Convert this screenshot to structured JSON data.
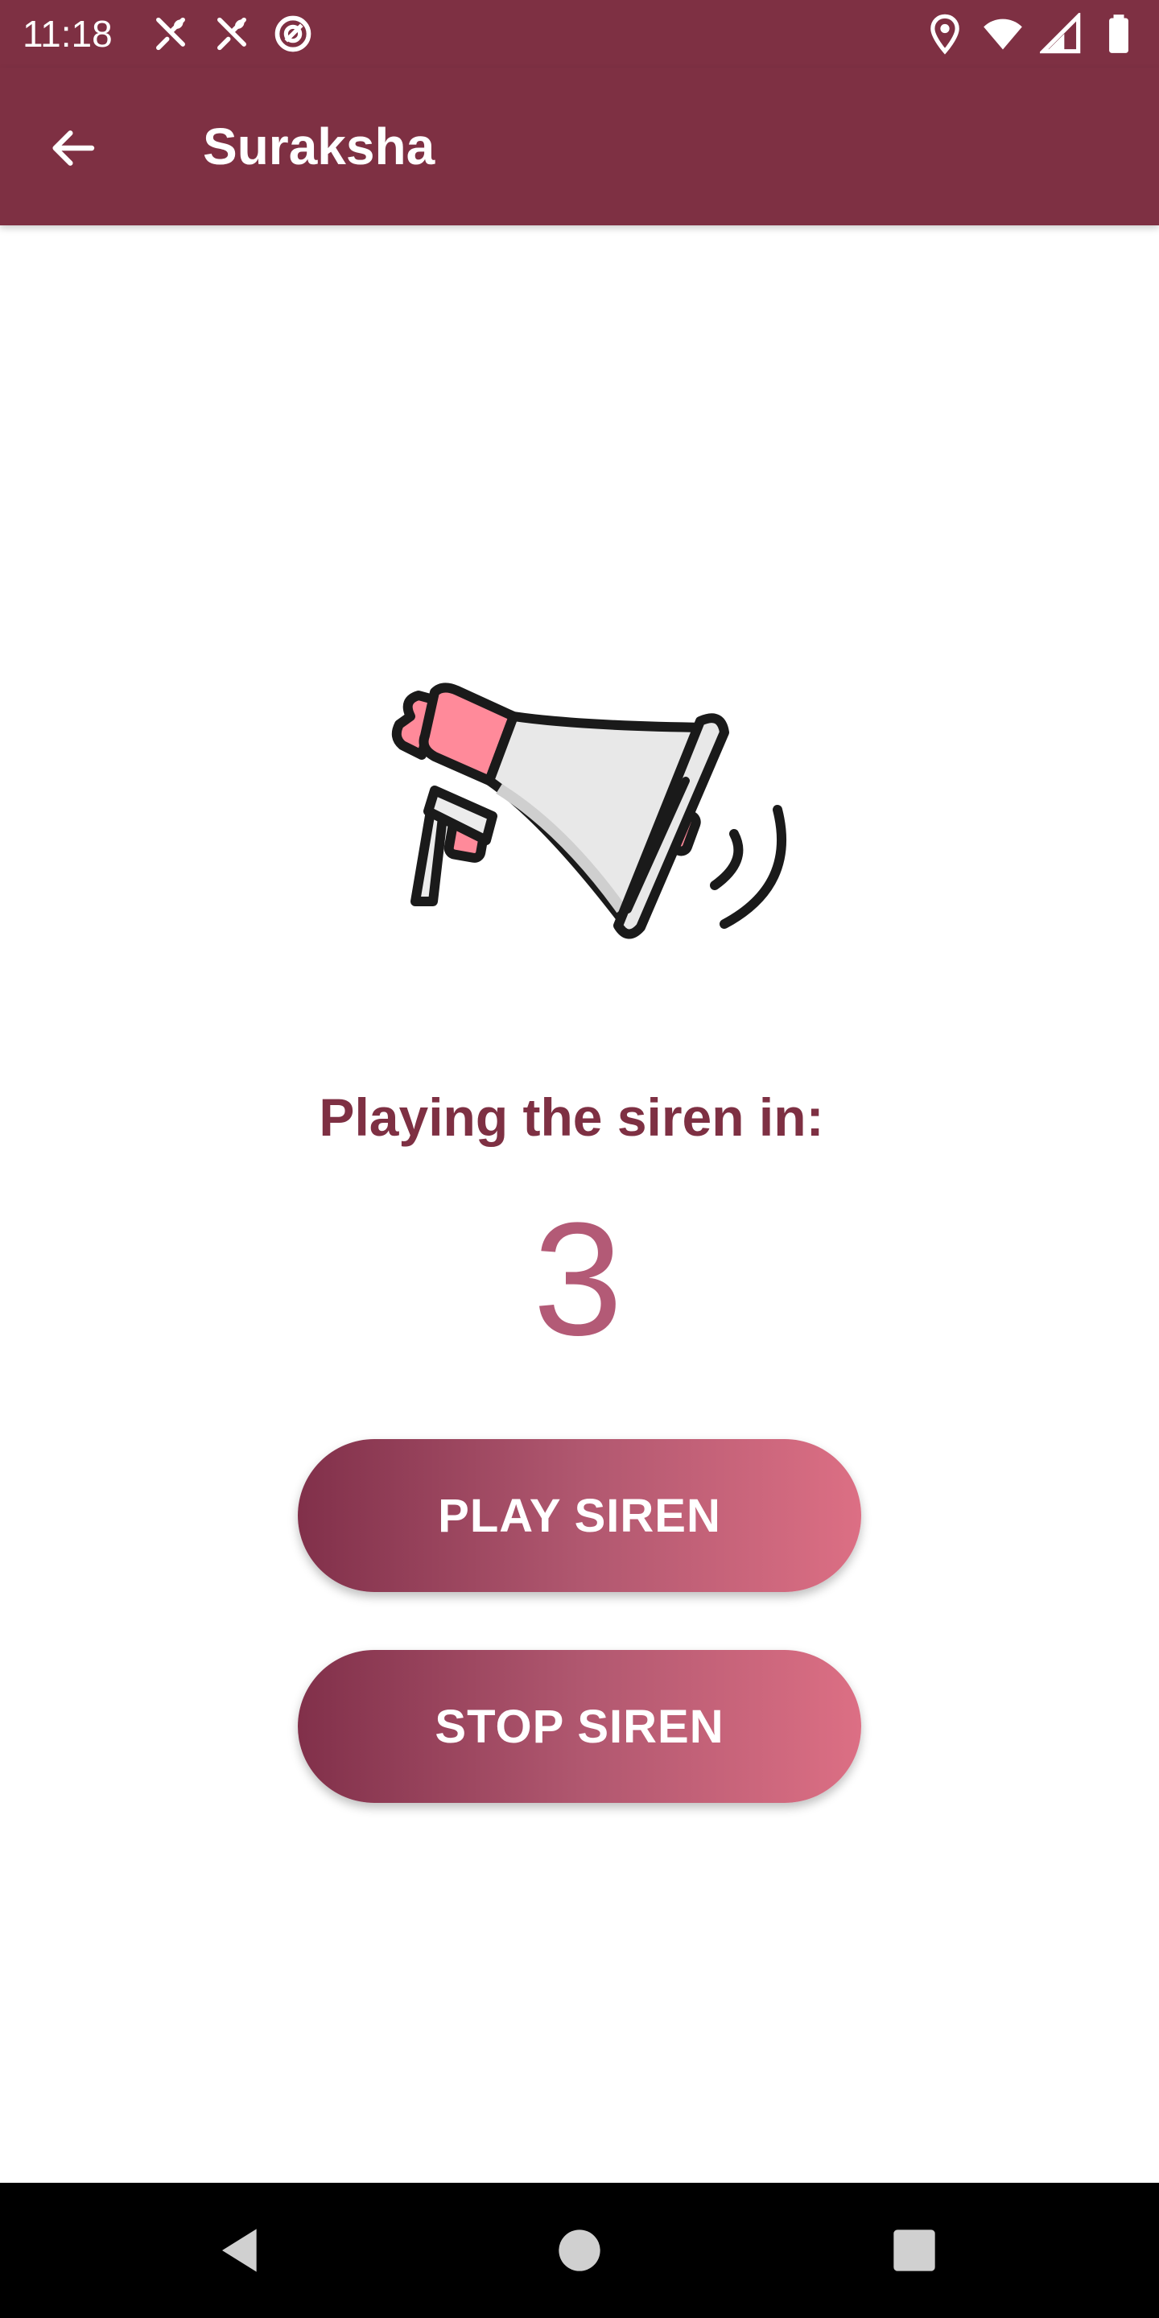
{
  "status_bar": {
    "time": "11:18",
    "left_icons": [
      "restaurant-icon",
      "restaurant-icon",
      "no-disturb-icon"
    ],
    "right_icons": [
      "location-icon",
      "wifi-icon",
      "signal-icon",
      "battery-icon"
    ]
  },
  "app_bar": {
    "title": "Suraksha",
    "back_icon": "arrow-back-icon"
  },
  "content": {
    "illustration": "megaphone-icon",
    "countdown_label": "Playing the siren in:",
    "countdown_value": "3"
  },
  "buttons": {
    "play_label": "PLAY SIREN",
    "stop_label": "STOP SIREN"
  },
  "nav_bar": {
    "back_icon": "triangle-back-icon",
    "home_icon": "circle-home-icon",
    "recents_icon": "square-recents-icon"
  },
  "colors": {
    "primary": "#7e3043",
    "countdown": "#b35a76",
    "gradient_start": "#81304a",
    "gradient_end": "#dc6f84",
    "accent_pink": "#ff8a9a"
  }
}
